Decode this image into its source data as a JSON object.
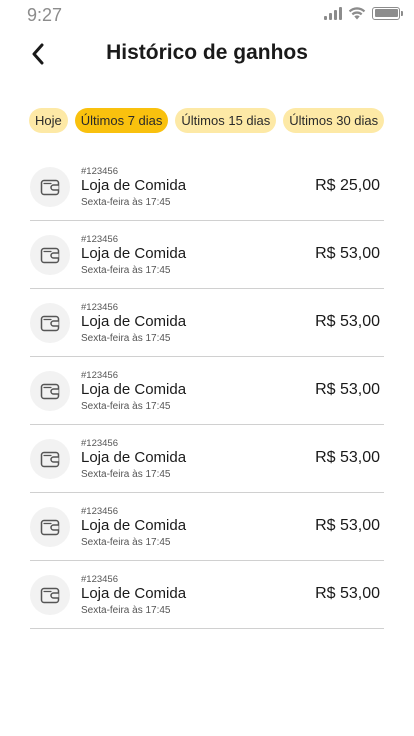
{
  "status_bar": {
    "time": "9:27"
  },
  "header": {
    "title": "Histórico de ganhos"
  },
  "filters": [
    {
      "label": "Hoje",
      "active": false
    },
    {
      "label": "Últimos 7 dias",
      "active": true
    },
    {
      "label": "Últimos 15 dias",
      "active": false
    },
    {
      "label": "Últimos 30 dias",
      "active": false
    }
  ],
  "earnings": [
    {
      "order_id": "#123456",
      "store": "Loja de Comida",
      "when": "Sexta-feira às 17:45",
      "amount": "R$ 25,00",
      "icon": "wallet-icon"
    },
    {
      "order_id": "#123456",
      "store": "Loja de Comida",
      "when": "Sexta-feira às 17:45",
      "amount": "R$ 53,00",
      "icon": "wallet-icon"
    },
    {
      "order_id": "#123456",
      "store": "Loja de Comida",
      "when": "Sexta-feira às 17:45",
      "amount": "R$ 53,00",
      "icon": "wallet-icon"
    },
    {
      "order_id": "#123456",
      "store": "Loja de Comida",
      "when": "Sexta-feira às 17:45",
      "amount": "R$ 53,00",
      "icon": "wallet-icon"
    },
    {
      "order_id": "#123456",
      "store": "Loja de Comida",
      "when": "Sexta-feira às 17:45",
      "amount": "R$ 53,00",
      "icon": "wallet-icon"
    },
    {
      "order_id": "#123456",
      "store": "Loja de Comida",
      "when": "Sexta-feira às 17:45",
      "amount": "R$ 53,00",
      "icon": "wallet-icon"
    },
    {
      "order_id": "#123456",
      "store": "Loja de Comida",
      "when": "Sexta-feira às 17:45",
      "amount": "R$ 53,00",
      "icon": "wallet-icon"
    }
  ],
  "colors": {
    "accent": "#f9c10e",
    "chip": "#fde9a6",
    "divider": "#d0d0d0"
  }
}
